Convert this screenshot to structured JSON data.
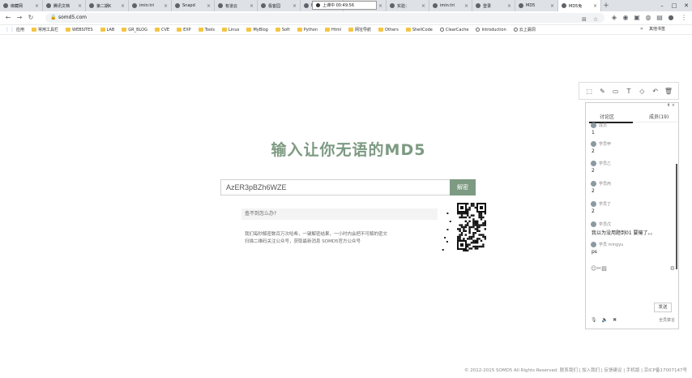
{
  "browser": {
    "tabs": [
      {
        "label": "绑藏网",
        "active": false
      },
      {
        "label": "腾讯文档",
        "active": false
      },
      {
        "label": "第二期K",
        "active": false
      },
      {
        "label": "imin:tri",
        "active": false
      },
      {
        "label": "Snapd",
        "active": false
      },
      {
        "label": "有道云",
        "active": false
      },
      {
        "label": "极客园",
        "active": false
      },
      {
        "label": "Blue",
        "active": false
      },
      {
        "label": "inux F",
        "active": false
      },
      {
        "label": "实验：",
        "active": false
      },
      {
        "label": "imin:tri",
        "active": false
      },
      {
        "label": "登录",
        "active": false
      },
      {
        "label": "MD5",
        "active": false
      },
      {
        "label": "MD5免",
        "active": true
      }
    ],
    "recording": {
      "label": "上课中 00:49:56"
    },
    "url": "somd5.com",
    "bookmarks": [
      {
        "label": "应用",
        "kind": "grid"
      },
      {
        "label": "常用工具栏",
        "kind": "folder"
      },
      {
        "label": "WEBSITES",
        "kind": "folder"
      },
      {
        "label": "LAB",
        "kind": "folder"
      },
      {
        "label": "GR_BLOG",
        "kind": "folder"
      },
      {
        "label": "CVE",
        "kind": "folder"
      },
      {
        "label": "EXP",
        "kind": "folder"
      },
      {
        "label": "Tools",
        "kind": "folder"
      },
      {
        "label": "Linux",
        "kind": "folder"
      },
      {
        "label": "MyBlog",
        "kind": "folder"
      },
      {
        "label": "Soft",
        "kind": "folder"
      },
      {
        "label": "Python",
        "kind": "folder"
      },
      {
        "label": "Html",
        "kind": "folder"
      },
      {
        "label": "网址导航",
        "kind": "folder"
      },
      {
        "label": "Others",
        "kind": "folder"
      },
      {
        "label": "ShellCode",
        "kind": "folder"
      },
      {
        "label": "ClearCache",
        "kind": "globe"
      },
      {
        "label": "Introduction",
        "kind": "globe"
      },
      {
        "label": "云上漏洞",
        "kind": "globe"
      }
    ],
    "bookmarks_more": "»",
    "other_bookmarks": "其他书签"
  },
  "page": {
    "title": "输入让你无语的MD5",
    "hash_value": "AzER3pBZh6WZE",
    "decrypt_label": "解密",
    "info_heading": "查不到怎么办?",
    "info_lines": [
      "我们每秒解密数百万次哈希，一键解密结果，一小时内会把不可解的密文",
      "扫描二维码关注公众号，获取最新消息 SOMD5官方公众号"
    ],
    "footer": "© 2012-2015 SOMD5 All Rights Reserved. 联系我们 | 加入我们 | 反馈建议 | 手机版 | 京ICP备17007147号"
  },
  "annotation_tools": [
    "select-icon",
    "pen-icon",
    "rect-icon",
    "text-icon",
    "highlighter-icon",
    "undo-icon",
    "delete-icon"
  ],
  "panel": {
    "tab_discussion": "讨论区",
    "tab_members": "成员(19)",
    "messages": [
      {
        "user": "成员",
        "text": "1"
      },
      {
        "user": "学员甲",
        "text": "2"
      },
      {
        "user": "学员乙",
        "text": "2"
      },
      {
        "user": "学员丙",
        "text": "2"
      },
      {
        "user": "学员丁",
        "text": "2"
      },
      {
        "user": "学员戊",
        "text": "我以为没用题到01  要输了。。"
      },
      {
        "user": "学员 mingyu",
        "text": "ps"
      }
    ],
    "send_label": "发送",
    "bottom_label": "全员禁言"
  }
}
